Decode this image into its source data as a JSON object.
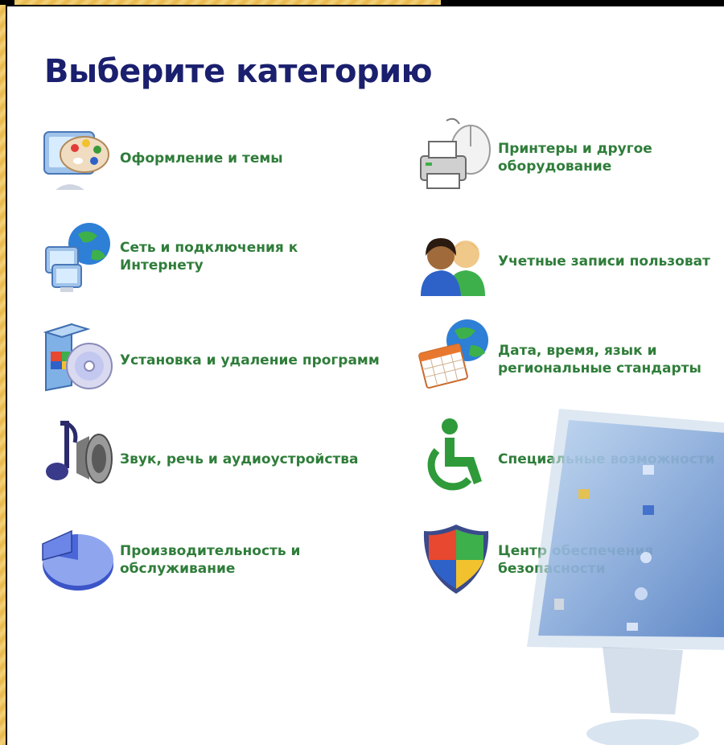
{
  "title": "Выберите категорию",
  "categories": [
    {
      "label": "Оформление и темы",
      "icon": "appearance-themes-icon"
    },
    {
      "label": "Принтеры и другое\nоборудование",
      "icon": "printer-mouse-icon"
    },
    {
      "label": "Сеть и подключения к\nИнтернету",
      "icon": "network-globe-icon"
    },
    {
      "label": "Учетные записи пользоват",
      "icon": "user-accounts-icon"
    },
    {
      "label": "Установка и удаление программ",
      "icon": "install-cd-icon"
    },
    {
      "label": "Дата, время, язык и\nрегиональные стандарты",
      "icon": "calendar-globe-icon"
    },
    {
      "label": "Звук, речь и аудиоустройства",
      "icon": "music-speaker-icon"
    },
    {
      "label": "Специальные возможности",
      "icon": "accessibility-icon"
    },
    {
      "label": "Производительность и\nобслуживание",
      "icon": "performance-pie-icon"
    },
    {
      "label": "Центр обеспечения\nбезопасности",
      "icon": "security-shield-icon"
    }
  ],
  "colors": {
    "title": "#1a1f6e",
    "link": "#2f7d3a",
    "background": "#ffffff"
  }
}
